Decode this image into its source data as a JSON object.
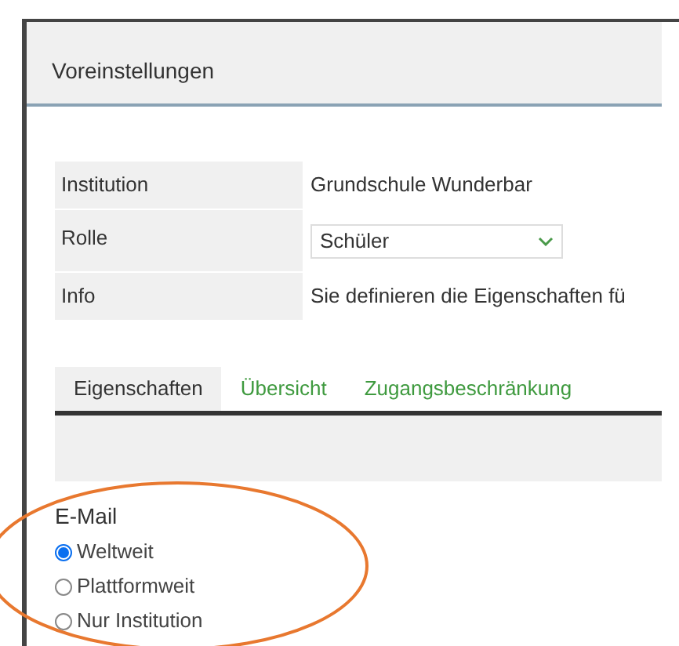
{
  "header": {
    "title": "Voreinstellungen"
  },
  "info_table": {
    "rows": [
      {
        "kind": "text",
        "label": "Institution",
        "value": "Grundschule Wunderbar"
      },
      {
        "kind": "select",
        "label": "Rolle",
        "value": "Schüler"
      },
      {
        "kind": "text",
        "label": "Info",
        "value": "Sie definieren die Eigenschaften fü"
      }
    ]
  },
  "tabs": [
    {
      "label": "Eigenschaften",
      "selected": true
    },
    {
      "label": "Übersicht",
      "selected": false
    },
    {
      "label": "Zugangsbeschränkung",
      "selected": false
    }
  ],
  "email": {
    "label": "E-Mail",
    "options": [
      {
        "label": "Weltweit",
        "selected": true
      },
      {
        "label": "Plattformweit",
        "selected": false
      },
      {
        "label": "Nur Institution",
        "selected": false
      }
    ]
  }
}
